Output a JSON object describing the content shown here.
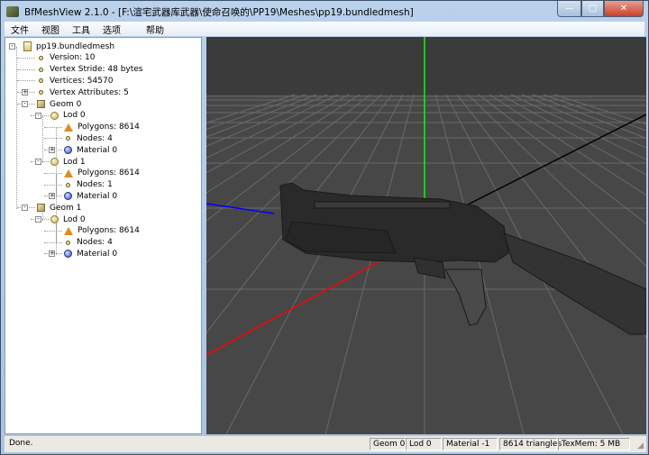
{
  "window": {
    "title": "BfMeshView 2.1.0 - [F:\\渲宅武器库武器\\使命召唤的\\PP19\\Meshes\\pp19.bundledmesh]",
    "controls": {
      "minimize": "minimize-icon",
      "maximize": "maximize-icon",
      "close": "close-icon"
    }
  },
  "menu": [
    "文件",
    "视图",
    "工具",
    "选项",
    "帮助"
  ],
  "tree": {
    "root": "pp19.bundledmesh",
    "version": "Version: 10",
    "stride": "Vertex Stride: 48 bytes",
    "vertices": "Vertices: 54570",
    "attributes": "Vertex Attributes: 5",
    "geoms": [
      {
        "label": "Geom 0",
        "lods": [
          {
            "label": "Lod 0",
            "polygons": "Polygons: 8614",
            "nodes": "Nodes: 4",
            "material": "Material 0"
          },
          {
            "label": "Lod 1",
            "polygons": "Polygons: 8614",
            "nodes": "Nodes: 1",
            "material": "Material 0"
          }
        ]
      },
      {
        "label": "Geom 1",
        "lods": [
          {
            "label": "Lod 0",
            "polygons": "Polygons: 8614",
            "nodes": "Nodes: 4",
            "material": "Material 0"
          }
        ]
      }
    ]
  },
  "viewport": {
    "axis_colors": {
      "x": "#ff0000",
      "y": "#00ff00",
      "z": "#0000ff"
    },
    "background": "#3b3b3b"
  },
  "status": {
    "message": "Done.",
    "geom": "Geom 0",
    "lod": "Lod 0",
    "material": "Material -1",
    "triangles": "8614 triangles",
    "texmem": "TexMem: 5 MB"
  }
}
